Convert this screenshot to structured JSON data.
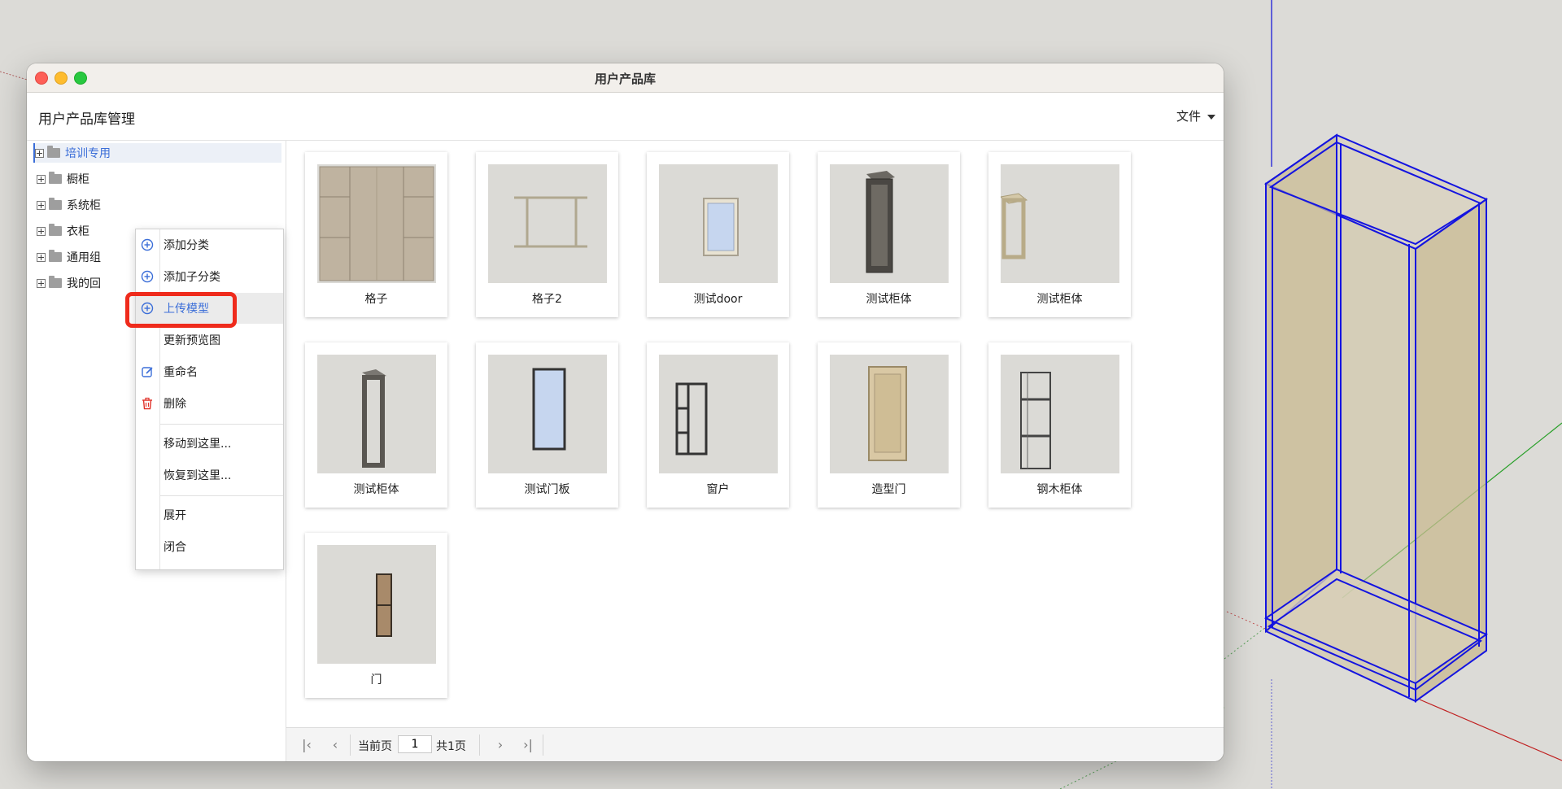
{
  "window": {
    "title": "用户产品库"
  },
  "header": {
    "app_title": "用户产品库管理",
    "file_menu": "文件"
  },
  "tree": [
    {
      "label": "培训专用",
      "selected": true
    },
    {
      "label": "橱柜"
    },
    {
      "label": "系统柜"
    },
    {
      "label": "衣柜"
    },
    {
      "label": "通用组"
    },
    {
      "label": "我的回"
    }
  ],
  "context_menu": [
    {
      "label": "添加分类",
      "icon": "plus-circle-icon"
    },
    {
      "label": "添加子分类",
      "icon": "plus-circle-icon"
    },
    {
      "label": "上传模型",
      "icon": "plus-circle-icon",
      "highlighted": true
    },
    {
      "label": "更新预览图"
    },
    {
      "label": "重命名",
      "icon": "edit-icon"
    },
    {
      "label": "删除",
      "icon": "trash-icon"
    },
    {
      "label": "移动到这里..."
    },
    {
      "label": "恢复到这里..."
    },
    {
      "label": "展开"
    },
    {
      "label": "闭合"
    }
  ],
  "products": [
    {
      "label": "格子",
      "thumb": "grid-panel"
    },
    {
      "label": "格子2",
      "thumb": "frame-bars"
    },
    {
      "label": "测试door",
      "thumb": "small-glass-door"
    },
    {
      "label": "测试柜体",
      "thumb": "dark-tall-cabinet"
    },
    {
      "label": "测试柜体",
      "thumb": "beige-frame"
    },
    {
      "label": "测试柜体",
      "thumb": "dark-open-frame"
    },
    {
      "label": "测试门板",
      "thumb": "glass-panel"
    },
    {
      "label": "窗户",
      "thumb": "window-frame"
    },
    {
      "label": "造型门",
      "thumb": "wood-door"
    },
    {
      "label": "钢木柜体",
      "thumb": "steel-shelf"
    },
    {
      "label": "门",
      "thumb": "small-wood-door"
    }
  ],
  "pager": {
    "current_label": "当前页",
    "current_page": "1",
    "total_label": "共1页"
  },
  "colors": {
    "accent": "#3b6ed8",
    "highlight_box": "#ef2b1c"
  }
}
